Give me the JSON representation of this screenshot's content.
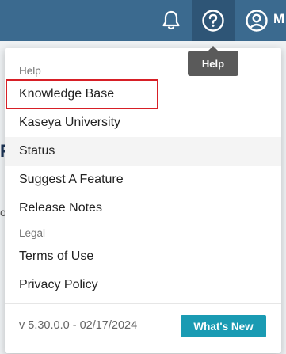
{
  "topbar": {
    "bell_icon": "bell-icon",
    "help_icon": "question-circle-icon",
    "user_icon": "user-circle-icon",
    "user_initial": "M",
    "bg_color": "#3b6a8f"
  },
  "tooltip": {
    "text": "Help"
  },
  "background": {
    "heading_fragment": "F",
    "text_fragment": "o"
  },
  "menu": {
    "help_section_label": "Help",
    "items": [
      {
        "label": "Knowledge Base"
      },
      {
        "label": "Kaseya University"
      },
      {
        "label": "Status"
      },
      {
        "label": "Suggest A Feature"
      },
      {
        "label": "Release Notes"
      }
    ],
    "legal_section_label": "Legal",
    "legal_items": [
      {
        "label": "Terms of Use"
      },
      {
        "label": "Privacy Policy"
      }
    ],
    "version": "v 5.30.0.0 - 02/17/2024",
    "whats_new_label": "What's New"
  },
  "colors": {
    "accent": "#1a9bb3",
    "highlight": "#d71f26"
  }
}
